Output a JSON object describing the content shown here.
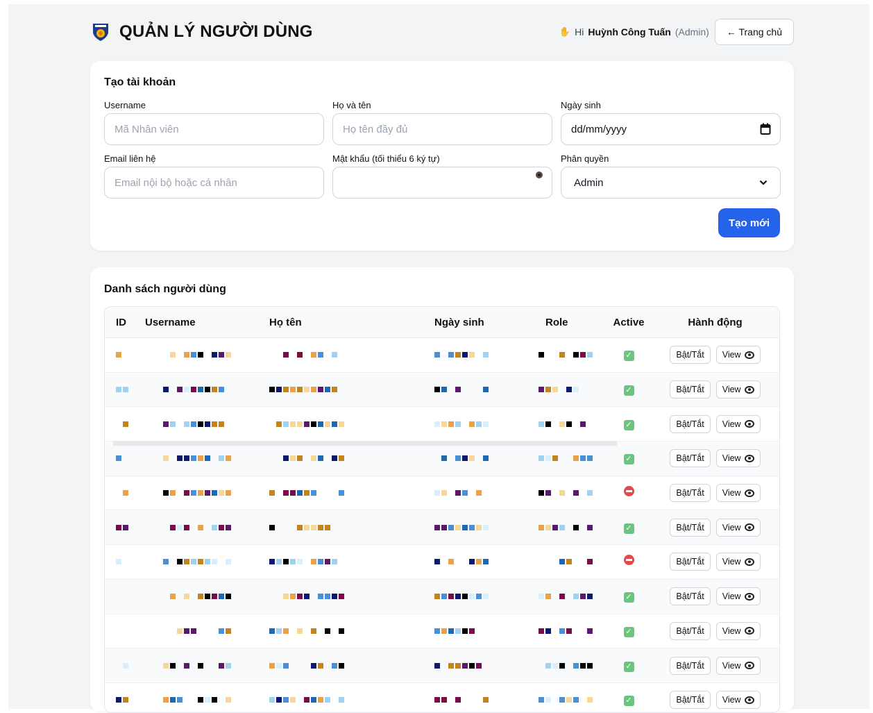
{
  "header": {
    "title": "QUẢN LÝ NGƯỜI DÙNG",
    "greeting_prefix": "Hi",
    "user_name": "Huỳnh Công Tuấn",
    "user_role": "(Admin)",
    "home_button": "← Trang chủ"
  },
  "create_form": {
    "title": "Tạo tài khoản",
    "username_label": "Username",
    "username_placeholder": "Mã Nhân viên",
    "fullname_label": "Họ và tên",
    "fullname_placeholder": "Họ tên đầy đủ",
    "dob_label": "Ngày sinh",
    "dob_value": "dd/mm/yyyy",
    "email_label": "Email liên hệ",
    "email_placeholder": "Email nội bộ hoặc cá nhân",
    "password_label": "Mật khẩu (tối thiểu 6 ký tự)",
    "role_label": "Phân quyền",
    "role_selected": "Admin",
    "submit_button": "Tạo mới"
  },
  "user_list": {
    "title": "Danh sách người dùng",
    "columns": [
      "ID",
      "Username",
      "Họ tên",
      "Ngày sinh",
      "Role",
      "Active",
      "Hành động"
    ],
    "toggle_button": "Bật/Tắt",
    "view_button": "View",
    "rows": [
      {
        "active": true
      },
      {
        "active": true
      },
      {
        "active": true
      },
      {
        "active": true
      },
      {
        "active": false
      },
      {
        "active": true
      },
      {
        "active": false
      },
      {
        "active": true
      },
      {
        "active": true
      },
      {
        "active": true
      },
      {
        "active": true
      }
    ]
  },
  "colors": {
    "primary": "#2563eb",
    "active_ok": "#6cc57f",
    "inactive": "#e5484d"
  }
}
